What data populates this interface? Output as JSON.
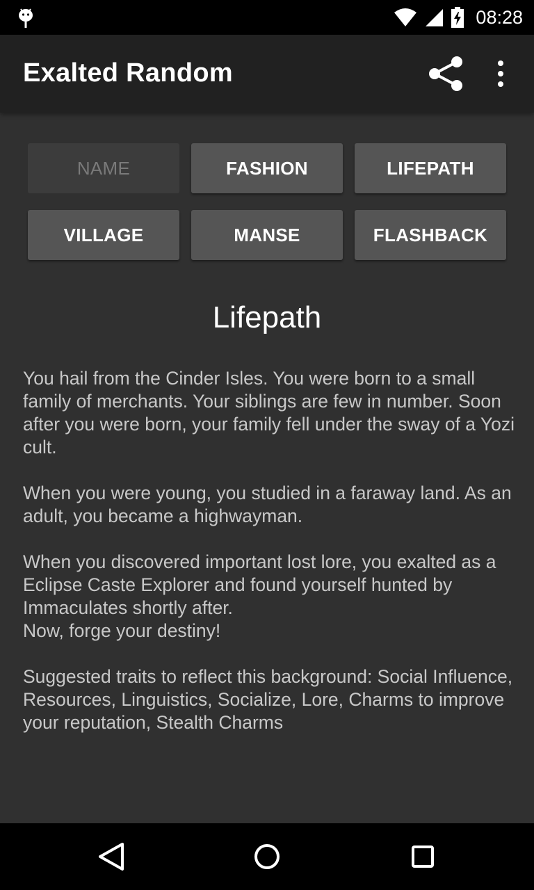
{
  "status_bar": {
    "time": "08:28",
    "icons": [
      "android-debug-icon",
      "wifi-icon",
      "cell-signal-icon",
      "battery-charging-icon"
    ]
  },
  "app_bar": {
    "title": "Exalted Random",
    "actions": [
      "share-icon",
      "more-vert-icon"
    ]
  },
  "buttons": [
    {
      "label": "NAME",
      "enabled": false
    },
    {
      "label": "FASHION",
      "enabled": true
    },
    {
      "label": "LIFEPATH",
      "enabled": true
    },
    {
      "label": "VILLAGE",
      "enabled": true
    },
    {
      "label": "MANSE",
      "enabled": true
    },
    {
      "label": "FLASHBACK",
      "enabled": true
    }
  ],
  "content": {
    "title": "Lifepath",
    "paragraphs": [
      "You hail from the Cinder Isles. You were born to a small family of merchants. Your siblings are few in number. Soon after you were born, your family fell under the sway of a Yozi cult.",
      "When you were young, you studied in a faraway land. As an adult, you became a highwayman.",
      "When you discovered important lost lore, you exalted as a Eclipse Caste Explorer and found yourself hunted by Immaculates shortly after.",
      "Now, forge your destiny!",
      "Suggested traits to reflect this background: Social Influence, Resources, Linguistics, Socialize, Lore, Charms to improve your reputation, Stealth Charms"
    ]
  },
  "nav_bar": {
    "buttons": [
      "back-icon",
      "home-icon",
      "recents-icon"
    ]
  },
  "colors": {
    "background": "#303030",
    "app_bar": "#212121",
    "button": "#555555",
    "button_disabled": "#3c3c3c",
    "text_primary": "#ffffff",
    "text_body": "#c8c8c8"
  }
}
